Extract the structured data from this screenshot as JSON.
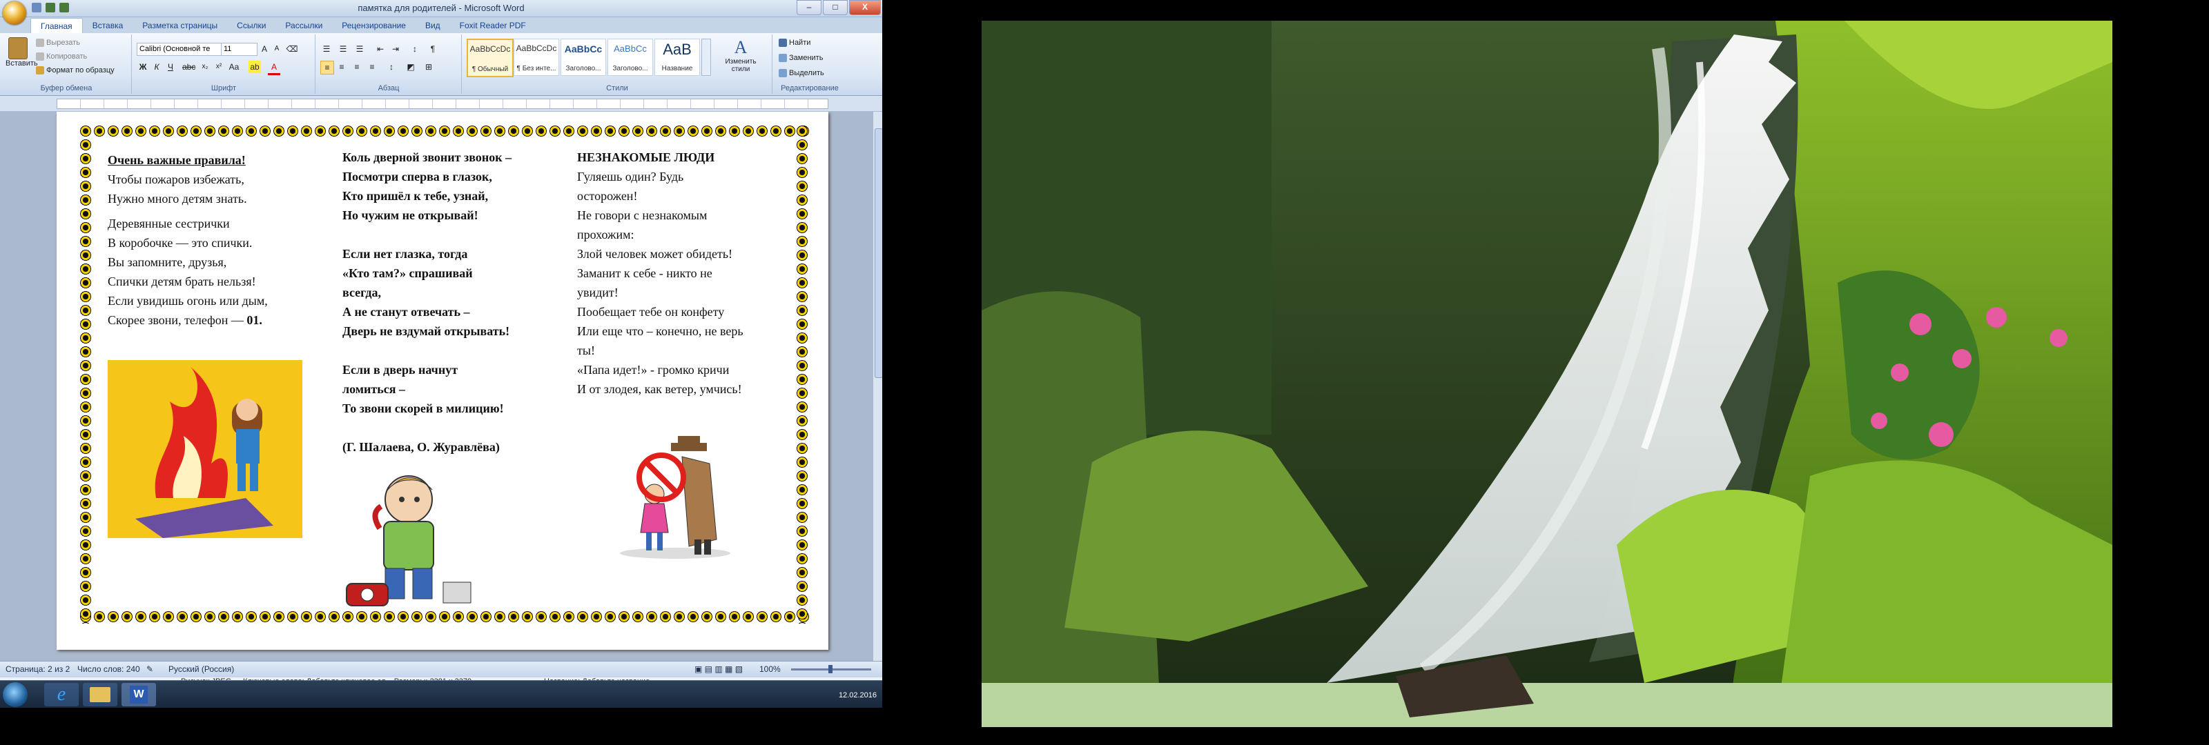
{
  "window": {
    "title": "памятка для родителей - Microsoft Word",
    "controls": {
      "minimize": "–",
      "maximize": "□",
      "close": "X"
    }
  },
  "ribbon": {
    "tabs": [
      "Главная",
      "Вставка",
      "Разметка страницы",
      "Ссылки",
      "Рассылки",
      "Рецензирование",
      "Вид",
      "Foxit Reader PDF"
    ],
    "clipboard": {
      "paste": "Вставить",
      "cut": "Вырезать",
      "copy": "Копировать",
      "format_painter": "Формат по образцу",
      "caption": "Буфер обмена"
    },
    "font": {
      "family": "Calibri (Основной те",
      "size": "11",
      "caption": "Шрифт"
    },
    "paragraph": {
      "caption": "Абзац"
    },
    "styles": {
      "items": [
        {
          "preview": "AaBbCcDc",
          "label": "¶ Обычный"
        },
        {
          "preview": "AaBbCcDc",
          "label": "¶ Без инте..."
        },
        {
          "preview": "AaBbCc",
          "label": "Заголово..."
        },
        {
          "preview": "AaBbCc",
          "label": "Заголово..."
        },
        {
          "preview": "AaB",
          "label": "Название"
        }
      ],
      "change": "Изменить стили",
      "caption": "Стили"
    },
    "editing": {
      "find": "Найти",
      "replace": "Заменить",
      "select": "Выделить",
      "caption": "Редактирование"
    }
  },
  "document": {
    "col1": {
      "title": "Очень важные правила!",
      "lines_a": [
        "Чтобы пожаров избежать,",
        "Нужно много детям знать."
      ],
      "lines_b": [
        "Деревянные сестрички",
        "В коробочке — это спички.",
        "Вы запомните,  друзья,",
        "Спички детям брать нельзя!",
        "Если увидишь огонь или дым,"
      ],
      "last_line": "Скорее звони, телефон — ",
      "phone": "01."
    },
    "col2": {
      "stanza1": [
        "Коль дверной звонит звонок –",
        "Посмотри сперва в глазок,",
        "Кто пришёл к тебе, узнай,",
        "Но чужим не открывай!"
      ],
      "stanza2": [
        "Если нет глазка, тогда",
        "«Кто там?» спрашивай",
        "всегда,",
        "А не станут отвечать  –",
        "Дверь не вздумай  открывать!"
      ],
      "stanza3": [
        "Если в дверь начнут",
        "ломиться –",
        "То звони скорей в милицию!"
      ],
      "authors": "(Г. Шалаева, О. Журавлёва)"
    },
    "col3": {
      "title": "НЕЗНАКОМЫЕ  ЛЮДИ",
      "lines": [
        "Гуляешь один? Будь",
        "осторожен!",
        "Не говори с незнакомым",
        "прохожим:",
        "Злой человек может обидеть!",
        "Заманит к себе - никто не",
        "увидит!",
        "Пообещает тебе он конфету",
        "Или еще что – конечно, не верь",
        "ты!",
        "«Папа идет!» - громко кричи",
        "И от злодея, как ветер, умчись!"
      ]
    }
  },
  "statusbar": {
    "page": "Страница: 2 из 2",
    "words": "Число слов: 240",
    "language": "Русский (Россия)",
    "zoom": "100%"
  },
  "hint_strip": {
    "left": "Рисунок JPEG",
    "middle": "Ключевые слова: Добавьте ключевое сл...  Размеры: 2381 x 3379",
    "right": "Название: Добавьте название"
  },
  "taskbar": {
    "date": "12.02.2016"
  },
  "colors": {
    "ribbon_bg": "#dbe6f4",
    "page_bg": "#ffffff",
    "border_yellow": "#f5d100",
    "desktop_bg": "#000000"
  }
}
